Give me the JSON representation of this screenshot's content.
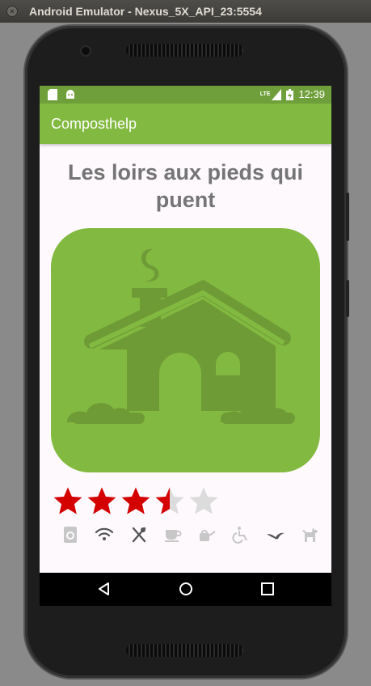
{
  "window": {
    "title": "Android Emulator - Nexus_5X_API_23:5554"
  },
  "status_bar": {
    "network": "LTE",
    "time": "12:39"
  },
  "app_bar": {
    "title": "Composthelp"
  },
  "place": {
    "name": "Les loirs aux pieds qui puent",
    "rating": 3.5,
    "max_rating": 5,
    "image": "house-illustration"
  },
  "amenities": [
    {
      "icon": "washing-machine-icon",
      "active": false
    },
    {
      "icon": "wifi-icon",
      "active": true
    },
    {
      "icon": "restaurant-icon",
      "active": true
    },
    {
      "icon": "coffee-icon",
      "active": false
    },
    {
      "icon": "watering-can-icon",
      "active": false
    },
    {
      "icon": "wheelchair-icon",
      "active": false
    },
    {
      "icon": "bird-icon",
      "active": true
    },
    {
      "icon": "dog-icon",
      "active": false
    }
  ],
  "colors": {
    "accent": "#82b940",
    "status_bar": "#6f9f3a",
    "star_filled": "#d40000",
    "star_empty": "#dcdcdc",
    "amenity_active": "#555555",
    "amenity_inactive": "#c7c7c7"
  }
}
